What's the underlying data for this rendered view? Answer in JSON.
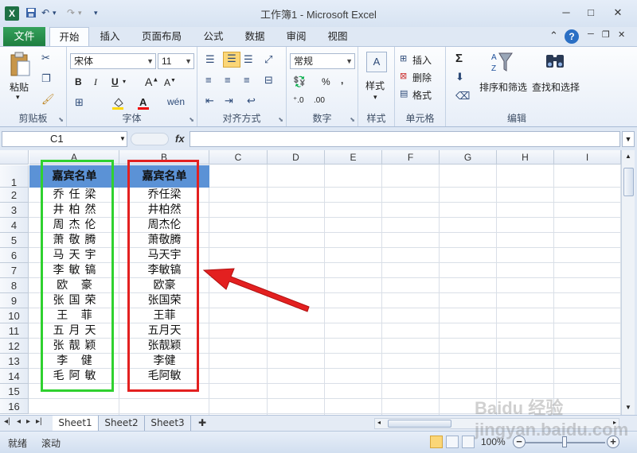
{
  "window": {
    "title": "工作簿1 - Microsoft Excel",
    "min": "─",
    "max": "□",
    "close": "✕"
  },
  "qat": {
    "save": "💾",
    "undo": "↶",
    "redo": "↷",
    "more": "▾"
  },
  "tabs": {
    "file": "文件",
    "items": [
      "开始",
      "插入",
      "页面布局",
      "公式",
      "数据",
      "审阅",
      "视图"
    ],
    "active": "开始"
  },
  "ribbon": {
    "clipboard": {
      "label": "剪贴板",
      "paste": "粘贴"
    },
    "font": {
      "label": "字体",
      "name": "宋体",
      "size": "11",
      "bold": "B",
      "italic": "I",
      "underline": "U"
    },
    "alignment": {
      "label": "对齐方式"
    },
    "number": {
      "label": "数字",
      "format": "常规",
      "percent": "%",
      "comma": ","
    },
    "styles": {
      "label": "样式",
      "button": "样式"
    },
    "cells": {
      "label": "单元格",
      "insert": "插入",
      "delete": "删除",
      "format": "格式"
    },
    "editing": {
      "label": "编辑",
      "sum": "Σ",
      "sort": "排序和筛选",
      "find": "查找和选择"
    }
  },
  "formula_bar": {
    "name_box": "C1",
    "fx": "fx",
    "value": ""
  },
  "columns": [
    "A",
    "B",
    "C",
    "D",
    "E",
    "F",
    "G",
    "H",
    "I"
  ],
  "rows": [
    "1",
    "2",
    "3",
    "4",
    "5",
    "6",
    "7",
    "8",
    "9",
    "10",
    "11",
    "12",
    "13",
    "14",
    "15",
    "16"
  ],
  "colA": {
    "header": "嘉宾名单",
    "names": [
      "乔任梁",
      "井柏然",
      "周杰伦",
      "萧敬腾",
      "马天宇",
      "李敏镐",
      "欧 豪",
      "张国荣",
      "王 菲",
      "五月天",
      "张靓颖",
      "李 健",
      "毛阿敏"
    ]
  },
  "colB": {
    "header": "嘉宾名单",
    "names": [
      "乔任梁",
      "井柏然",
      "周杰伦",
      "萧敬腾",
      "马天宇",
      "李敏镐",
      "欧豪",
      "张国荣",
      "王菲",
      "五月天",
      "张靓颖",
      "李健",
      "毛阿敏"
    ]
  },
  "sheets": [
    "Sheet1",
    "Sheet2",
    "Sheet3"
  ],
  "active_sheet": "Sheet1",
  "status": {
    "ready": "就绪",
    "scroll": "滚动",
    "zoom": "100%"
  },
  "watermark": "Baidu 经验 jingyan.baidu.com",
  "colors": {
    "green_box": "#2fd12f",
    "red_box": "#e32020",
    "header_fill": "#5b92d6",
    "arrow": "#e32020"
  }
}
